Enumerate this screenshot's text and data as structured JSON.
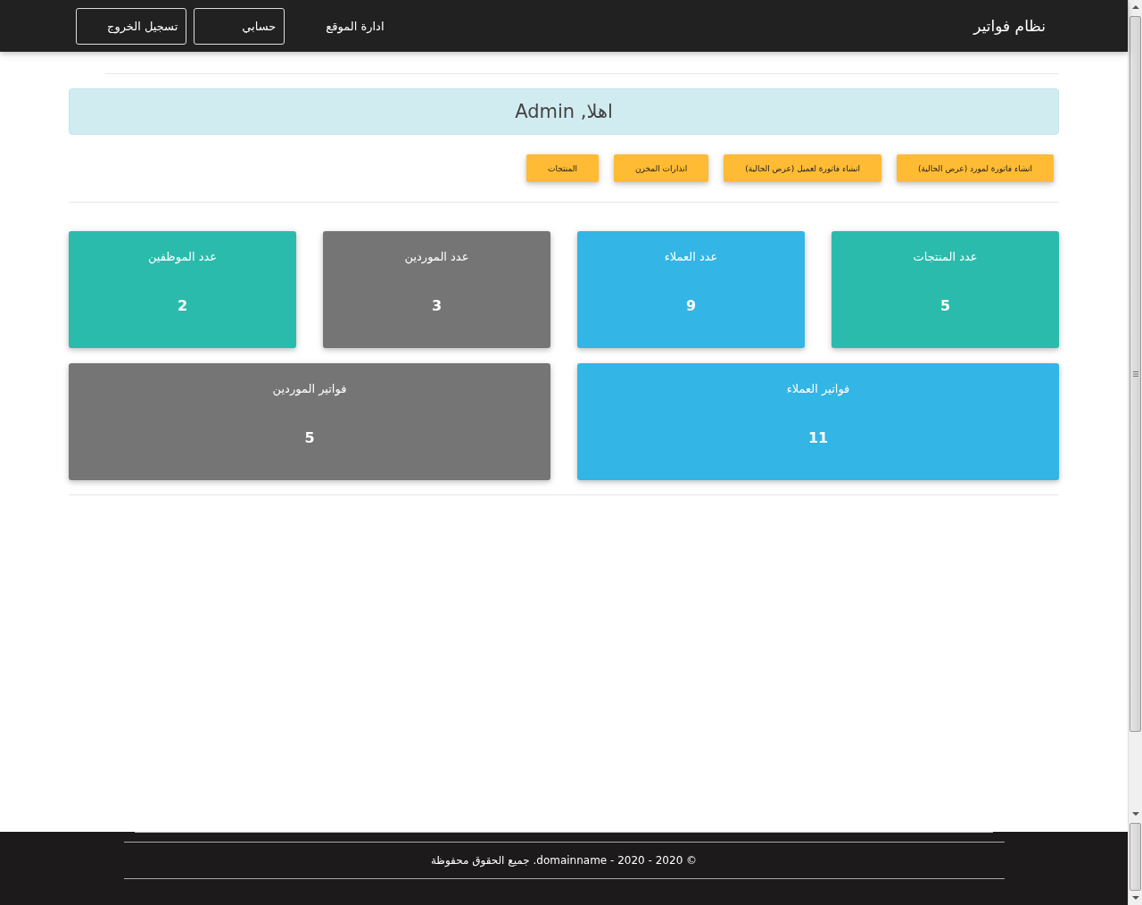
{
  "navbar": {
    "brand": "نظام فواتير",
    "links": [
      {
        "label": "ادارة الموقع",
        "kind": "link"
      },
      {
        "label": "حسابي",
        "kind": "outline"
      },
      {
        "label": "تسجيل الخروج",
        "kind": "outline"
      }
    ]
  },
  "welcome": {
    "text": "اهلا, Admin"
  },
  "actions": [
    {
      "label": "انشاء فاتورة لمورد (عرض الحالية)"
    },
    {
      "label": "انشاء فاتورة لعميل (عرض الحالية)"
    },
    {
      "label": "انذارات المخزن"
    },
    {
      "label": "المنتجات"
    }
  ],
  "stats": [
    {
      "title": "عدد المنتجات",
      "value": "5",
      "color": "#2bbbad"
    },
    {
      "title": "عدد العملاء",
      "value": "9",
      "color": "#33b5e5"
    },
    {
      "title": "عدد الموردين",
      "value": "3",
      "color": "#757575"
    },
    {
      "title": "عدد الموظفين",
      "value": "2",
      "color": "#2bbbad"
    }
  ],
  "invoices": [
    {
      "title": "فواتير العملاء",
      "value": "11",
      "color": "#33b5e5"
    },
    {
      "title": "فواتير الموردين",
      "value": "5",
      "color": "#757575"
    }
  ],
  "footer": {
    "text": "© 2020 - 2020 - domainname. جميع الحقوق محفوظة"
  }
}
